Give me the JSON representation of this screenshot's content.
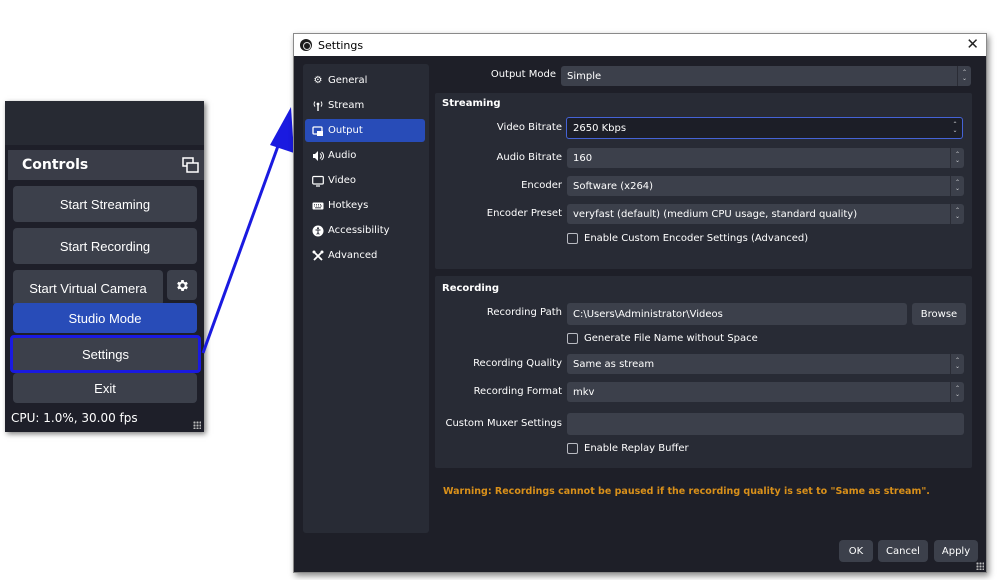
{
  "controls": {
    "title": "Controls",
    "buttons": {
      "start_streaming": "Start Streaming",
      "start_recording": "Start Recording",
      "start_virtual_camera": "Start Virtual Camera",
      "studio_mode": "Studio Mode",
      "settings": "Settings",
      "exit": "Exit"
    },
    "status": "CPU: 1.0%, 30.00 fps"
  },
  "settings_window": {
    "title": "Settings",
    "sidebar": {
      "items": [
        {
          "label": "General",
          "icon": "gear-icon"
        },
        {
          "label": "Stream",
          "icon": "antenna-icon"
        },
        {
          "label": "Output",
          "icon": "output-icon",
          "active": true
        },
        {
          "label": "Audio",
          "icon": "speaker-icon"
        },
        {
          "label": "Video",
          "icon": "monitor-icon"
        },
        {
          "label": "Hotkeys",
          "icon": "keyboard-icon"
        },
        {
          "label": "Accessibility",
          "icon": "accessibility-icon"
        },
        {
          "label": "Advanced",
          "icon": "tools-icon"
        }
      ]
    },
    "output_mode": {
      "label": "Output Mode",
      "value": "Simple"
    },
    "streaming": {
      "title": "Streaming",
      "video_bitrate": {
        "label": "Video Bitrate",
        "value": "2650 Kbps"
      },
      "audio_bitrate": {
        "label": "Audio Bitrate",
        "value": "160"
      },
      "encoder": {
        "label": "Encoder",
        "value": "Software (x264)"
      },
      "encoder_preset": {
        "label": "Encoder Preset",
        "value": "veryfast (default) (medium CPU usage, standard quality)"
      },
      "custom_encoder_checkbox": {
        "label": "Enable Custom Encoder Settings (Advanced)",
        "checked": false
      }
    },
    "recording": {
      "title": "Recording",
      "path": {
        "label": "Recording Path",
        "value": "C:\\Users\\Administrator\\Videos"
      },
      "browse_label": "Browse",
      "no_space_checkbox": {
        "label": "Generate File Name without Space",
        "checked": false
      },
      "quality": {
        "label": "Recording Quality",
        "value": "Same as stream"
      },
      "format": {
        "label": "Recording Format",
        "value": "mkv"
      },
      "muxer": {
        "label": "Custom Muxer Settings",
        "value": ""
      },
      "replay_checkbox": {
        "label": "Enable Replay Buffer",
        "checked": false
      }
    },
    "warning": "Warning: Recordings cannot be paused if the recording quality is set to \"Same as stream\".",
    "buttons": {
      "ok": "OK",
      "cancel": "Cancel",
      "apply": "Apply"
    }
  },
  "colors": {
    "accent": "#284cb8",
    "highlight_border": "#1a1ae0",
    "warning": "#d9901a"
  }
}
